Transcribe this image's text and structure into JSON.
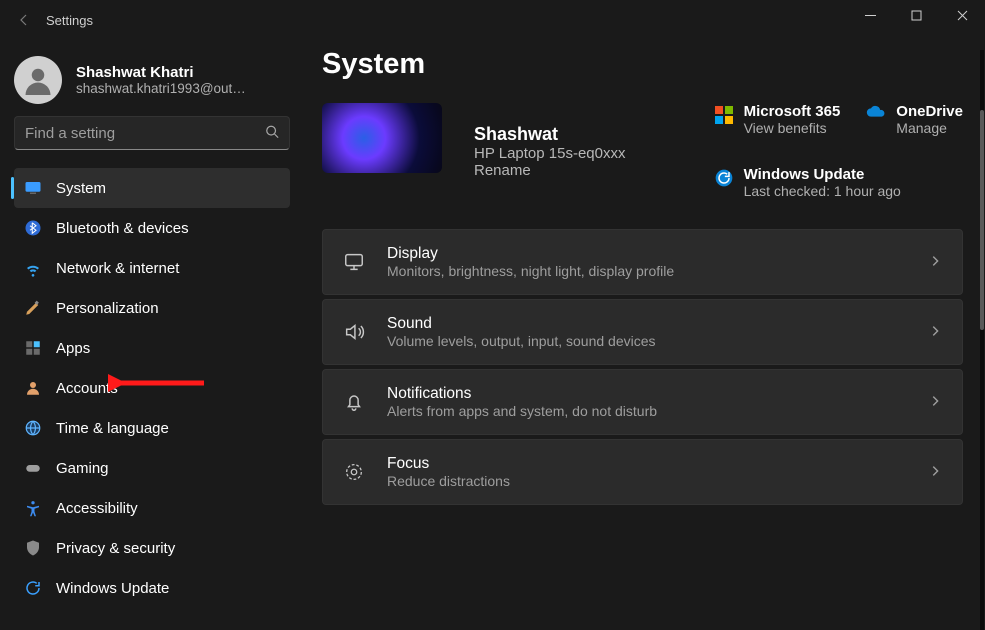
{
  "app_title": "Settings",
  "user": {
    "name": "Shashwat Khatri",
    "email": "shashwat.khatri1993@out…"
  },
  "search": {
    "placeholder": "Find a setting"
  },
  "nav": [
    {
      "label": "System",
      "icon": "monitor",
      "selected": true
    },
    {
      "label": "Bluetooth & devices",
      "icon": "bluetooth",
      "selected": false
    },
    {
      "label": "Network & internet",
      "icon": "wifi",
      "selected": false
    },
    {
      "label": "Personalization",
      "icon": "brush",
      "selected": false
    },
    {
      "label": "Apps",
      "icon": "apps",
      "selected": false
    },
    {
      "label": "Accounts",
      "icon": "person",
      "selected": false
    },
    {
      "label": "Time & language",
      "icon": "globe-time",
      "selected": false
    },
    {
      "label": "Gaming",
      "icon": "gamepad",
      "selected": false
    },
    {
      "label": "Accessibility",
      "icon": "accessibility",
      "selected": false
    },
    {
      "label": "Privacy & security",
      "icon": "shield",
      "selected": false
    },
    {
      "label": "Windows Update",
      "icon": "update",
      "selected": false
    }
  ],
  "page": {
    "title": "System",
    "device": {
      "name": "Shashwat",
      "model": "HP Laptop 15s-eq0xxx",
      "rename": "Rename"
    },
    "tiles": {
      "m365": {
        "title": "Microsoft 365",
        "sub": "View benefits"
      },
      "onedrive": {
        "title": "OneDrive",
        "sub": "Manage"
      },
      "update": {
        "title": "Windows Update",
        "sub": "Last checked: 1 hour ago"
      }
    },
    "cards": [
      {
        "title": "Display",
        "sub": "Monitors, brightness, night light, display profile",
        "icon": "display"
      },
      {
        "title": "Sound",
        "sub": "Volume levels, output, input, sound devices",
        "icon": "sound"
      },
      {
        "title": "Notifications",
        "sub": "Alerts from apps and system, do not disturb",
        "icon": "bell"
      },
      {
        "title": "Focus",
        "sub": "Reduce distractions",
        "icon": "focus"
      }
    ]
  },
  "annotation": {
    "arrow_color": "#ff1a1a"
  }
}
